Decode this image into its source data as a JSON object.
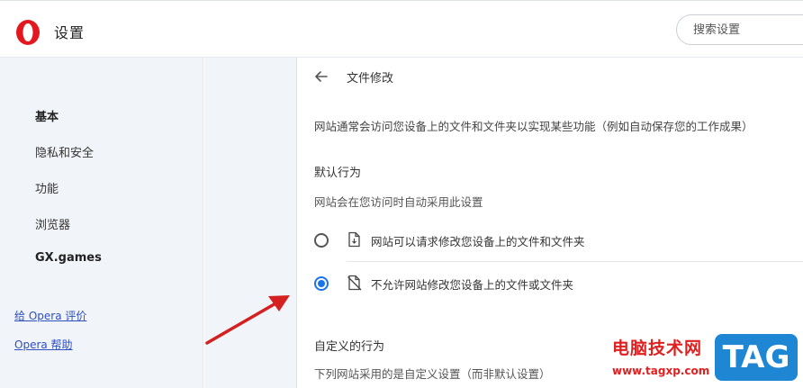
{
  "header": {
    "app_title": "设置",
    "search_placeholder": "搜索设置"
  },
  "sidebar": {
    "items": [
      {
        "label": "基本",
        "active": true
      },
      {
        "label": "隐私和安全",
        "active": false
      },
      {
        "label": "功能",
        "active": false
      },
      {
        "label": "浏览器",
        "active": false
      },
      {
        "label": "GX.games",
        "active": false
      }
    ],
    "links": [
      {
        "label": "给 Opera 评价"
      },
      {
        "label": "Opera 帮助"
      }
    ]
  },
  "main": {
    "title": "文件修改",
    "description": "网站通常会访问您设备上的文件和文件夹以实现某些功能（例如自动保存您的工作成果）",
    "default_section": {
      "title": "默认行为",
      "subtitle": "网站会在您访问时自动采用此设置",
      "options": [
        {
          "label": "网站可以请求修改您设备上的文件和文件夹",
          "checked": false,
          "icon": "file-edit-icon"
        },
        {
          "label": "不允许网站修改您设备上的文件或文件夹",
          "checked": true,
          "icon": "file-edit-off-icon"
        }
      ]
    },
    "custom_section": {
      "title": "自定义的行为",
      "subtitle": "下列网站采用的是自定义设置（而非默认设置）"
    }
  },
  "watermark": {
    "text": "电脑技术网",
    "url": "www.tagxp.com",
    "badge": "TAG"
  },
  "colors": {
    "accent": "#1a73e8",
    "sidebar_bg": "#f1f4f8",
    "link": "#2e4fbf",
    "logo_red": "#e4171f",
    "annotation_arrow": "#d42020"
  }
}
